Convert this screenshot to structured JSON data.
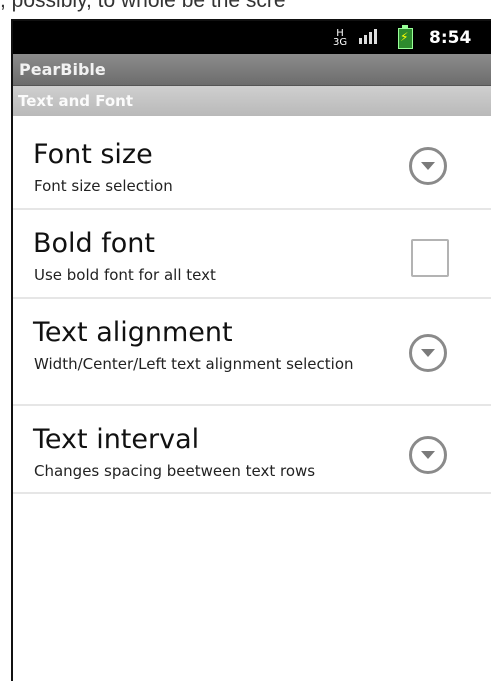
{
  "status_bar": {
    "network_top": "H",
    "network_bottom": "3G",
    "time": "8:54"
  },
  "app": {
    "title": "PearBible"
  },
  "category": {
    "label": "Text and Font"
  },
  "prefs": [
    {
      "title": "Font size",
      "summary": "Font size selection",
      "widget": "dropdown"
    },
    {
      "title": "Bold font",
      "summary": "Use bold font for all text",
      "widget": "checkbox",
      "checked": false
    },
    {
      "title": "Text alignment",
      "summary": "Width/Center/Left text alignment selection",
      "widget": "dropdown"
    },
    {
      "title": "Text interval",
      "summary": "Changes spacing beetween text rows",
      "widget": "dropdown"
    }
  ],
  "colors": {
    "status_bar": "#000000",
    "title_bar": "#7a7a7a",
    "category_bar": "#c4c4c4"
  }
}
